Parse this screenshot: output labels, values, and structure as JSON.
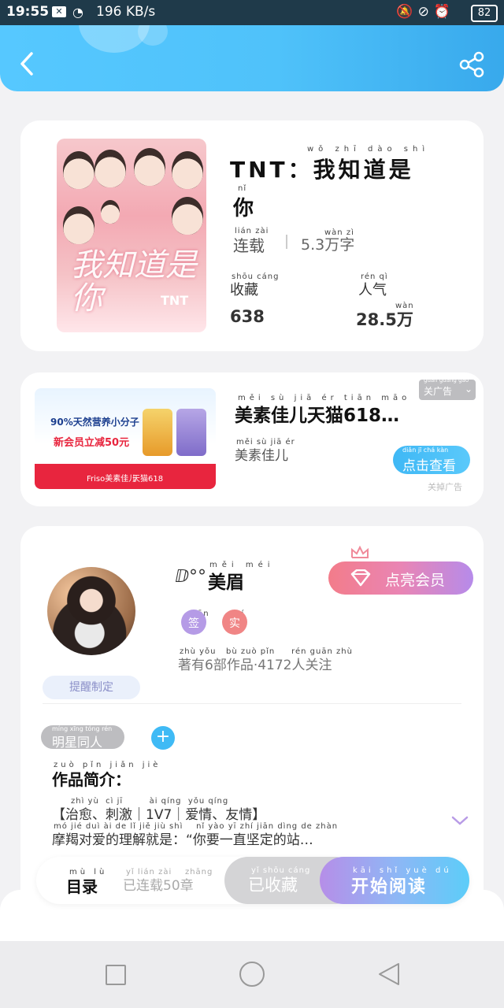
{
  "status_bar": {
    "time": "19:55",
    "speed": "196 KB/s",
    "battery": "82"
  },
  "book": {
    "title_main": "TNT：我知道是",
    "title_main_pinyin": "wǒ zhī dào shì",
    "title_line2": "你",
    "title_line2_pinyin": "nǐ",
    "status": "连载",
    "status_pinyin": "lián zài",
    "word_count": "5.3万字",
    "word_count_pinyin": "wàn zì",
    "favorites_label": "收藏",
    "favorites_pinyin": "shōu cáng",
    "favorites_value": "638",
    "popularity_label": "人气",
    "popularity_pinyin": "rén qì",
    "popularity_value": "28.5万",
    "popularity_value_pinyin": "wàn",
    "cover_text": "我知道是你",
    "cover_tag": "TNT"
  },
  "ad": {
    "title": "美素佳儿天猫618…",
    "title_pinyin": "měi sù jiā ér tiān māo",
    "subtitle": "美素佳儿",
    "subtitle_pinyin": "měi sù jiā ér",
    "close_label": "关广告",
    "close_pinyin": "guān guǎng gào",
    "button_label": "点击查看",
    "button_pinyin": "diǎn jī chá kàn",
    "footer": "关掉广告",
    "img_line1": "90%天然营养小分子",
    "img_line2": "新会员立减50元",
    "img_brand": "Friso美素佳儿",
    "img_tmall": "天猫618"
  },
  "author": {
    "name": "美眉",
    "name_pinyin": "měi méi",
    "name_prefix": "ⅅ°°",
    "vip_button": "点亮会员",
    "badge_sign": "签",
    "badge_sign_pinyin": "qiān",
    "badge_real": "实",
    "badge_real_pinyin": "shí",
    "stats": "著有6部作品·4172人关注",
    "stats_pinyin": "zhù yǒu   bù zuò pǐn     rén guān zhù",
    "title_tag": "提醒制定"
  },
  "tags": {
    "first": "明星同人",
    "first_pinyin": "míng xīng tóng rén",
    "add": "+"
  },
  "intro": {
    "heading": "作品简介：",
    "heading_pinyin": "zuò pǐn jiǎn jiè",
    "line1": "【治愈、刺激｜1V7｜爱情、友情】",
    "line1_pinyin": "zhì yù  cì jī        ài qíng  yǒu qíng",
    "line2": "摩羯对爱的理解就是：“你要一直坚定的站…",
    "line2_pinyin": "mó jié duì ài de lǐ jiě jiù shì    nǐ yào yī zhí jiān dìng de zhàn"
  },
  "bottom": {
    "catalog": "目录",
    "catalog_pinyin": "mù lù",
    "chapters": "已连载50章",
    "chapters_pinyin": "yǐ lián zài    zhāng",
    "collected": "已收藏",
    "collected_pinyin": "yǐ shōu cáng",
    "read": "开始阅读",
    "read_pinyin": "kāi shǐ yuè dú"
  }
}
